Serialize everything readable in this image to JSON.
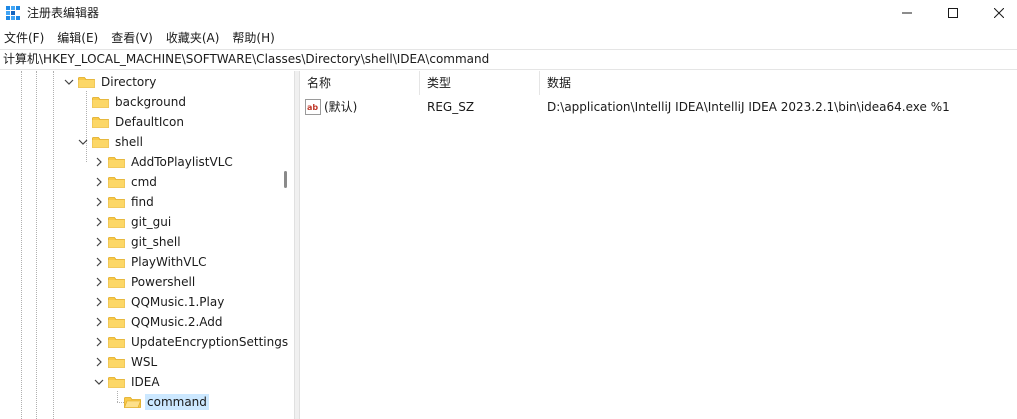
{
  "window": {
    "title": "注册表编辑器",
    "colors": {
      "accent": "#0078d4",
      "folder": "#f8c94a",
      "selection": "#cce8ff"
    }
  },
  "menu": {
    "file": "文件(F)",
    "edit": "编辑(E)",
    "view": "查看(V)",
    "favorites": "收藏夹(A)",
    "help": "帮助(H)"
  },
  "address": "计算机\\HKEY_LOCAL_MACHINE\\SOFTWARE\\Classes\\Directory\\shell\\IDEA\\command",
  "tree": {
    "directory": "Directory",
    "background": "background",
    "defaulticon": "DefaultIcon",
    "shell": "shell",
    "children": [
      "AddToPlaylistVLC",
      "cmd",
      "find",
      "git_gui",
      "git_shell",
      "PlayWithVLC",
      "Powershell",
      "QQMusic.1.Play",
      "QQMusic.2.Add",
      "UpdateEncryptionSettings",
      "WSL"
    ],
    "idea": "IDEA",
    "command": "command"
  },
  "list": {
    "headers": {
      "name": "名称",
      "type": "类型",
      "data": "数据"
    },
    "rows": [
      {
        "name": "(默认)",
        "type": "REG_SZ",
        "data": "D:\\application\\IntelliJ IDEA\\IntelliJ IDEA 2023.2.1\\bin\\idea64.exe %1"
      }
    ]
  }
}
